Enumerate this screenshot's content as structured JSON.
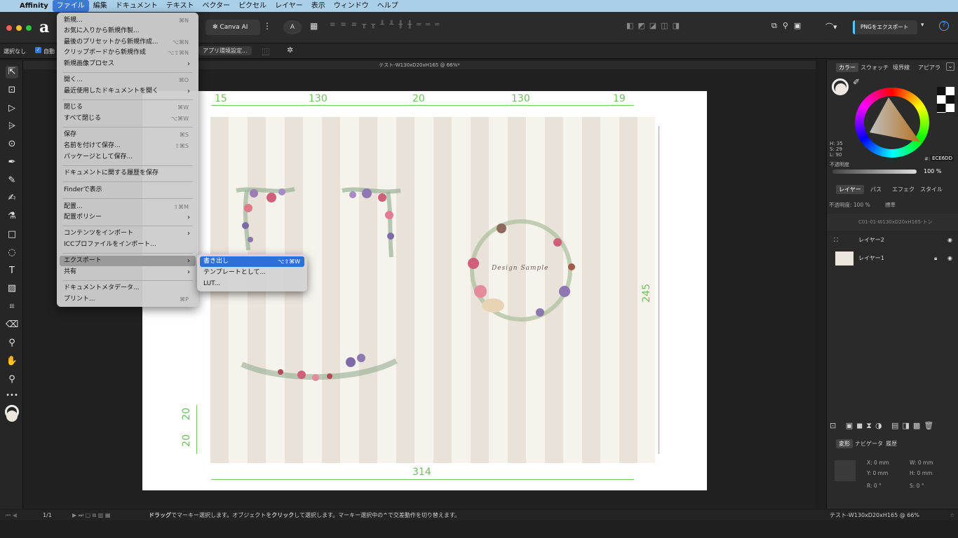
{
  "menubar": {
    "apple": "",
    "app": "Affinity",
    "items": [
      "ファイル",
      "編集",
      "ドキュメント",
      "テキスト",
      "ベクター",
      "ピクセル",
      "レイヤー",
      "表示",
      "ウィンドウ",
      "ヘルプ"
    ]
  },
  "toolbar": {
    "canva_ai": "Canva AI",
    "export_button": "PNGをエクスポート",
    "help": "?"
  },
  "context_bar": {
    "selection": "選択なし",
    "auto": "自動",
    "app_settings": "アプリ環境設定..."
  },
  "document": {
    "title": "テスト-W130xD20xH165 @ 66%*",
    "status_title": "テスト-W130xD20xH165 @ 66%"
  },
  "dimensions": {
    "top": [
      "15",
      "130",
      "20",
      "130",
      "19"
    ],
    "right": "245",
    "left_a": "20",
    "left_b": "20",
    "bottom": "314"
  },
  "artwork": {
    "wreath_text": "Design Sample"
  },
  "file_menu": {
    "items": [
      {
        "label": "新規...",
        "shortcut": "⌘N"
      },
      {
        "label": "お気に入りから新規作製...",
        "shortcut": ""
      },
      {
        "label": "最後のプリセットから新規作成...",
        "shortcut": "⌥⌘N"
      },
      {
        "label": "クリップボードから新規作成",
        "shortcut": "⌥⇧⌘N"
      },
      {
        "label": "新規画像プロセス",
        "shortcut": "›"
      },
      {
        "label": "開く...",
        "shortcut": "⌘O"
      },
      {
        "label": "最近使用したドキュメントを開く",
        "shortcut": "›"
      },
      {
        "label": "閉じる",
        "shortcut": "⌘W"
      },
      {
        "label": "すべて閉じる",
        "shortcut": "⌥⌘W"
      },
      {
        "label": "保存",
        "shortcut": "⌘S"
      },
      {
        "label": "名前を付けて保存...",
        "shortcut": "⇧⌘S"
      },
      {
        "label": "パッケージとして保存...",
        "shortcut": ""
      },
      {
        "label": "ドキュメントに関する履歴を保存",
        "shortcut": ""
      },
      {
        "label": "Finderで表示",
        "shortcut": ""
      },
      {
        "label": "配置...",
        "shortcut": "⇧⌘M"
      },
      {
        "label": "配置ポリシー",
        "shortcut": "›"
      },
      {
        "label": "コンテンツをインポート",
        "shortcut": "›"
      },
      {
        "label": "ICCプロファイルをインポート...",
        "shortcut": ""
      },
      {
        "label": "エクスポート",
        "shortcut": "›"
      },
      {
        "label": "共有",
        "shortcut": "›"
      },
      {
        "label": "ドキュメントメタデータ...",
        "shortcut": ""
      },
      {
        "label": "プリント...",
        "shortcut": "⌘P"
      }
    ]
  },
  "export_submenu": {
    "items": [
      {
        "label": "書き出し",
        "shortcut": "⌥⇧⌘W"
      },
      {
        "label": "テンプレートとして...",
        "shortcut": ""
      },
      {
        "label": "LUT...",
        "shortcut": ""
      }
    ]
  },
  "color_panel": {
    "tabs": [
      "カラー",
      "スウォッチ",
      "境界線",
      "アピアラ"
    ],
    "h": "H: 35",
    "s": "S: 29",
    "l": "L: 90",
    "opacity_label": "不透明度",
    "hex_label": "#:",
    "hex": "ECE6DD",
    "opacity_value": "100 %",
    "accent": "#ECE6DD"
  },
  "layers_panel": {
    "tabs": [
      "レイヤー",
      "パス",
      "エフェク",
      "スタイル"
    ],
    "opacity": "不透明度: 100 %",
    "blend": "標準",
    "rows": [
      "C01-01-W130xD20xH165-トン",
      "レイヤー2",
      "レイヤー1"
    ]
  },
  "transform_panel": {
    "tabs": [
      "変形",
      "ナビゲータ",
      "履歴"
    ],
    "x": "X: 0 mm",
    "y": "Y: 0 mm",
    "w": "W: 0 mm",
    "h": "H: 0 mm",
    "r": "R: 0 °",
    "s": "S: 0 °"
  },
  "statusbar": {
    "page": "1/1",
    "hint_1": "ドラッグ",
    "hint_2": "でマーキー選択します。オブジェクトを",
    "hint_3": "クリック",
    "hint_4": "して選択します。マーキー選択中の",
    "hint_5": "^",
    "hint_6": "で交差動作を切り替えます。"
  }
}
